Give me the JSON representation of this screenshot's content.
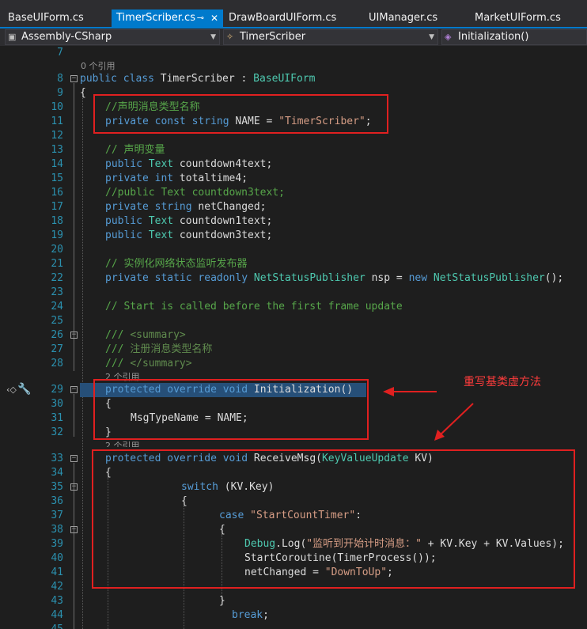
{
  "tabs": [
    {
      "label": "BaseUIForm.cs",
      "active": false
    },
    {
      "label": "TimerScriber.cs",
      "active": true
    },
    {
      "label": "DrawBoardUIForm.cs",
      "active": false
    },
    {
      "label": "UIManager.cs",
      "active": false
    },
    {
      "label": "MarketUIForm.cs",
      "active": false
    }
  ],
  "navbar": {
    "project": "Assembly-CSharp",
    "class": "TimerScriber",
    "member": "Initialization()"
  },
  "code_lines": [
    {
      "num": "7",
      "text": ""
    },
    {
      "num": "8",
      "text": "public class TimerScriber : BaseUIForm"
    },
    {
      "num": "9",
      "text": "{"
    },
    {
      "num": "10",
      "text": "//声明消息类型名称"
    },
    {
      "num": "11",
      "text": "private const string NAME = \"TimerScriber\";"
    },
    {
      "num": "12",
      "text": ""
    },
    {
      "num": "13",
      "text": "// 声明变量"
    },
    {
      "num": "14",
      "text": "public Text countdown4text;"
    },
    {
      "num": "15",
      "text": "private int totaltime4;"
    },
    {
      "num": "16",
      "text": "//public Text countdown3text;"
    },
    {
      "num": "17",
      "text": "private string netChanged;"
    },
    {
      "num": "18",
      "text": "public Text countdown1text;"
    },
    {
      "num": "19",
      "text": "public Text countdown3text;"
    },
    {
      "num": "20",
      "text": ""
    },
    {
      "num": "21",
      "text": "// 实例化网络状态监听发布器"
    },
    {
      "num": "22",
      "text": "private static readonly NetStatusPublisher nsp = new NetStatusPublisher();"
    },
    {
      "num": "23",
      "text": ""
    },
    {
      "num": "24",
      "text": "// Start is called before the first frame update"
    },
    {
      "num": "25",
      "text": ""
    },
    {
      "num": "26",
      "text": "/// <summary>"
    },
    {
      "num": "27",
      "text": "/// 注册消息类型名称"
    },
    {
      "num": "28",
      "text": "/// </summary>"
    },
    {
      "num": "29",
      "text": "protected override void Initialization()"
    },
    {
      "num": "30",
      "text": "{"
    },
    {
      "num": "31",
      "text": "MsgTypeName = NAME;"
    },
    {
      "num": "32",
      "text": "}"
    },
    {
      "num": "33",
      "text": "protected override void ReceiveMsg(KeyValueUpdate KV)"
    },
    {
      "num": "34",
      "text": "{"
    },
    {
      "num": "35",
      "text": "switch (KV.Key)"
    },
    {
      "num": "36",
      "text": "{"
    },
    {
      "num": "37",
      "text": "case \"StartCountTimer\":"
    },
    {
      "num": "38",
      "text": "{"
    },
    {
      "num": "39",
      "text": "Debug.Log(\"监听到开始计时消息：\" + KV.Key + KV.Values);"
    },
    {
      "num": "40",
      "text": "StartCoroutine(TimerProcess());"
    },
    {
      "num": "41",
      "text": "netChanged = \"DownToUp\";"
    },
    {
      "num": "42",
      "text": ""
    },
    {
      "num": "43",
      "text": "}"
    },
    {
      "num": "44",
      "text": "break;"
    },
    {
      "num": "45",
      "text": ""
    }
  ],
  "references": {
    "ref0": "0 个引用",
    "ref2a": "2 个引用",
    "ref2b": "2 个引用"
  },
  "annotation": "重写基类虚方法",
  "colors": {
    "background": "#1e1e1e",
    "active_tab": "#007acc",
    "annotation_red": "#e02020",
    "keyword": "#569cd6",
    "type": "#4ec9b0",
    "string": "#d69d85",
    "comment": "#57a64a",
    "line_number": "#2b91af"
  }
}
